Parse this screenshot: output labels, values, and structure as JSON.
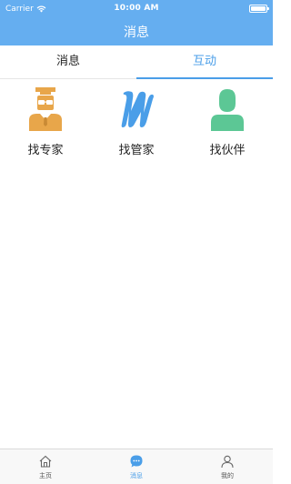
{
  "status_bar": {
    "carrier": "Carrier",
    "time": "10:00 AM",
    "battery_level": 1.0
  },
  "nav": {
    "title": "消息"
  },
  "tabs": [
    {
      "label": "消息",
      "active": false
    },
    {
      "label": "互动",
      "active": true
    }
  ],
  "grid": [
    {
      "label": "找专家",
      "icon": "expert-icon",
      "color": "#e8a64a"
    },
    {
      "label": "找管家",
      "icon": "m-logo-icon",
      "color": "#4a9ee8"
    },
    {
      "label": "找伙伴",
      "icon": "partner-icon",
      "color": "#5cc795"
    }
  ],
  "tabbar": [
    {
      "label": "主页",
      "icon": "home-icon",
      "active": false
    },
    {
      "label": "消息",
      "icon": "chat-icon",
      "active": true
    },
    {
      "label": "我的",
      "icon": "user-icon",
      "active": false
    }
  ],
  "colors": {
    "header": "#65aef0",
    "accent": "#4a9ee8"
  }
}
